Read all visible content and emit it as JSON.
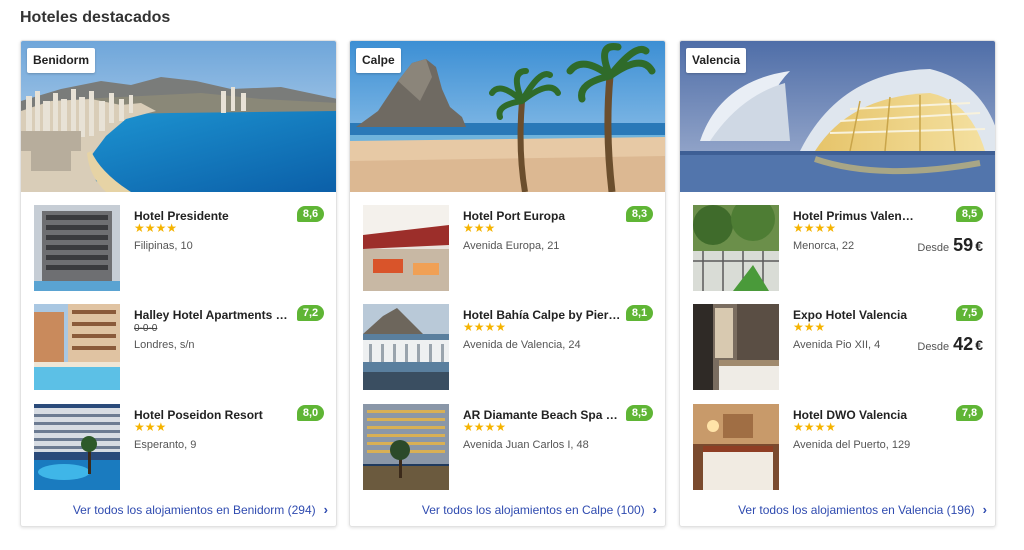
{
  "section": {
    "title": "Hoteles destacados"
  },
  "colors": {
    "rating_bg": "#5fb535",
    "stars": "#f5b300",
    "link": "#2f4bb0"
  },
  "cards": [
    {
      "city": "Benidorm",
      "see_all": "Ver todos los alojamientos en Benidorm (294)",
      "hotels": [
        {
          "name": "Hotel Presidente",
          "stars": "★★★★",
          "rating": "8,6",
          "address": "Filipinas, 10"
        },
        {
          "name": "Halley Hotel Apartments …",
          "stars": "0-0-0",
          "rating": "7,2",
          "address": "Londres, s/n"
        },
        {
          "name": "Hotel Poseidon Resort",
          "stars": "★★★",
          "rating": "8,0",
          "address": "Esperanto, 9"
        }
      ]
    },
    {
      "city": "Calpe",
      "see_all": "Ver todos los alojamientos en Calpe (100)",
      "hotels": [
        {
          "name": "Hotel Port Europa",
          "stars": "★★★",
          "rating": "8,3",
          "address": "Avenida Europa, 21"
        },
        {
          "name": "Hotel Bahía Calpe by Pier…",
          "stars": "★★★★",
          "rating": "8,1",
          "address": "Avenida de Valencia, 24"
        },
        {
          "name": "AR Diamante Beach Spa …",
          "stars": "★★★★",
          "rating": "8,5",
          "address": "Avenida Juan Carlos I, 48"
        }
      ]
    },
    {
      "city": "Valencia",
      "see_all": "Ver todos los alojamientos en Valencia (196)",
      "hotels": [
        {
          "name": "Hotel Primus Valen…",
          "stars": "★★★★",
          "rating": "8,5",
          "address": "Menorca, 22",
          "price_label": "Desde",
          "price": "59",
          "currency": "€"
        },
        {
          "name": "Expo Hotel Valencia",
          "stars": "★★★",
          "rating": "7,5",
          "address": "Avenida Pio XII, 4",
          "price_label": "Desde",
          "price": "42",
          "currency": "€"
        },
        {
          "name": "Hotel DWO Valencia",
          "stars": "★★★★",
          "rating": "7,8",
          "address": "Avenida del Puerto, 129"
        }
      ]
    }
  ]
}
